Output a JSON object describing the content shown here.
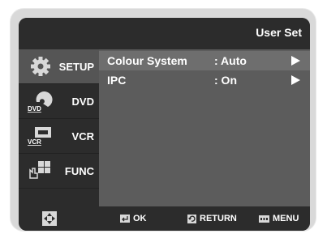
{
  "header": {
    "title": "User Set"
  },
  "sidebar": {
    "items": [
      {
        "label": "SETUP",
        "icon": "gear-icon",
        "active": true
      },
      {
        "label": "DVD",
        "icon": "dvd-disc-icon",
        "badge": "DVD"
      },
      {
        "label": "VCR",
        "icon": "vcr-tape-icon",
        "badge": "VCR"
      },
      {
        "label": "FUNC",
        "icon": "function-grid-icon"
      }
    ]
  },
  "menu": {
    "rows": [
      {
        "name": "Colour System",
        "value": ": Auto",
        "selected": true
      },
      {
        "name": "IPC",
        "value": ": On",
        "selected": false
      }
    ]
  },
  "footer": {
    "ok": "OK",
    "return": "RETURN",
    "menu": "MENU"
  },
  "colors": {
    "panel_dark": "#2c2c2c",
    "content_bg": "#5c5c5c",
    "selection": "#6e6e6e",
    "text": "#ffffff"
  }
}
